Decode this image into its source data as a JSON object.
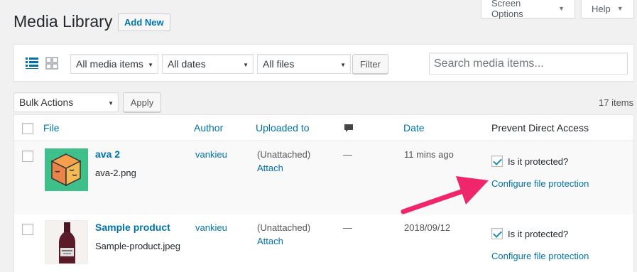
{
  "header": {
    "screen_options_label": "Screen Options",
    "help_label": "Help",
    "page_title": "Media Library",
    "add_new_label": "Add New"
  },
  "filters": {
    "media_type": "All media items",
    "dates": "All dates",
    "files": "All files",
    "filter_label": "Filter",
    "search_placeholder": "Search media items..."
  },
  "bulk": {
    "action": "Bulk Actions",
    "apply_label": "Apply",
    "count": "17 items"
  },
  "table": {
    "columns": {
      "file": "File",
      "author": "Author",
      "uploaded_to": "Uploaded to",
      "date": "Date",
      "protection": "Prevent Direct Access"
    },
    "rows": [
      {
        "title": "ava 2",
        "filename": "ava-2.png",
        "author": "vankieu",
        "uploaded_to": "(Unattached)",
        "attach_label": "Attach",
        "comments": "—",
        "date": "11 mins ago",
        "protected_label": "Is it protected?",
        "configure_label": "Configure file protection"
      },
      {
        "title": "Sample product",
        "filename": "Sample-product.jpeg",
        "author": "vankieu",
        "uploaded_to": "(Unattached)",
        "attach_label": "Attach",
        "comments": "—",
        "date": "2018/09/12",
        "protected_label": "Is it protected?",
        "configure_label": "Configure file protection"
      }
    ]
  },
  "colors": {
    "link": "#0073aa",
    "annotation_arrow": "#f0266b",
    "thumb1_bg": "#3fbf8a"
  }
}
